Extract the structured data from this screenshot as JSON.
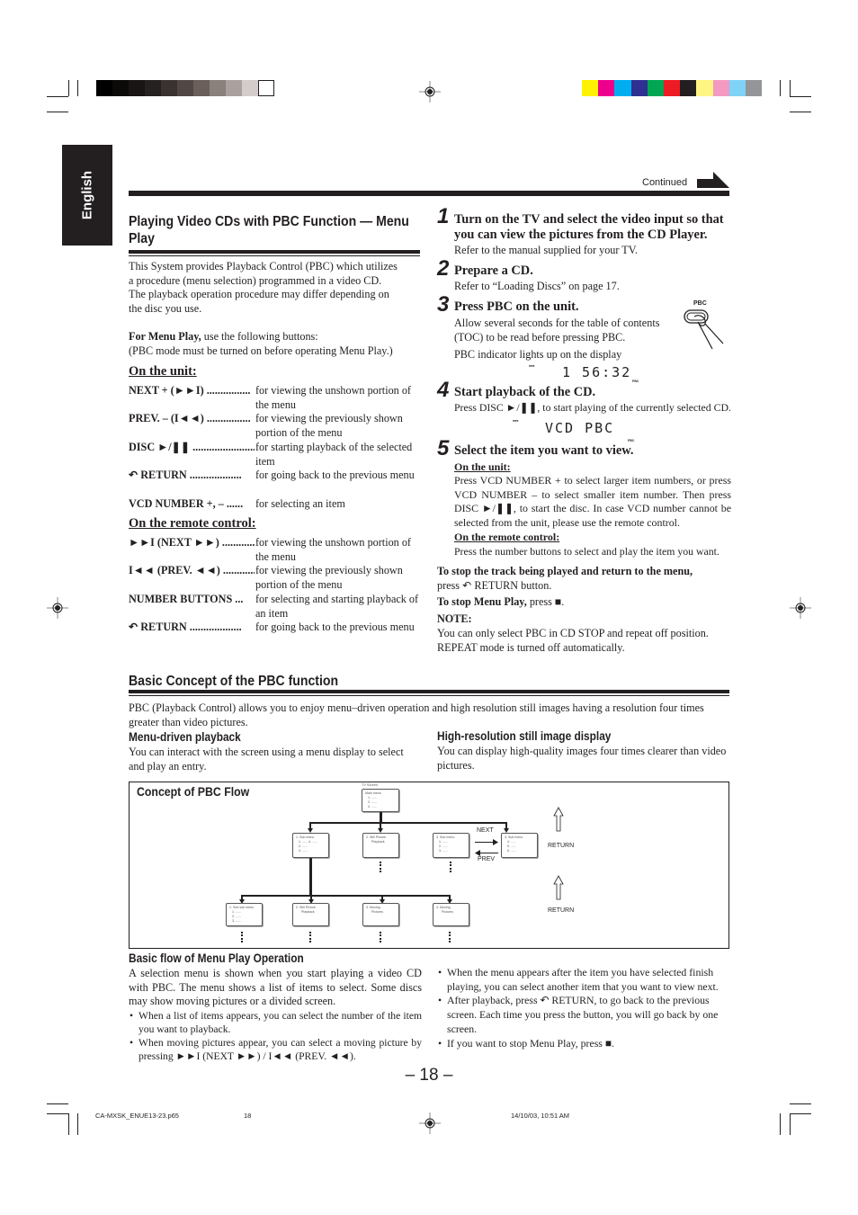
{
  "print_marks": {
    "grayscale_swatches": [
      "#000000",
      "#0b0a09",
      "#181514",
      "#252120",
      "#3a3230",
      "#514846",
      "#6a5f5b",
      "#8a807c",
      "#aaa19e",
      "#d4cccb",
      "#ffffff"
    ],
    "color_swatches": [
      "#fff200",
      "#ec008c",
      "#00aeef",
      "#2e3192",
      "#00a651",
      "#ed1c24",
      "#231f20",
      "#fff582",
      "#f49ac1",
      "#7fd3f7",
      "#939598"
    ]
  },
  "language_tab": "English",
  "continued_label": "Continued",
  "left": {
    "title_line1": "Playing Video CDs with PBC Function — Menu",
    "title_line2": "Play",
    "intro": [
      "This System provides Playback Control (PBC) which utilizes",
      "a procedure (menu selection) programmed in a video CD.",
      "The playback operation procedure may differ depending on",
      "the disc you use."
    ],
    "menu_play_bold": "For Menu Play,",
    "menu_play_rest": " use the following buttons:",
    "menu_play_note": "(PBC mode must be turned on before operating Menu Play.)",
    "unit_heading": "On the unit:",
    "unit_buttons": [
      {
        "key": "NEXT + (►►I) ................",
        "desc": "for viewing the unshown portion of the menu"
      },
      {
        "key": "PREV. – (I◄◄) ................",
        "desc": "for viewing the previously shown portion of the menu"
      },
      {
        "key": "DISC ►/❚❚ ........................",
        "desc": "for starting playback of the selected item"
      },
      {
        "key": "↶ RETURN ...................",
        "desc": "for going back to the previous menu"
      },
      {
        "key": "VCD NUMBER +, – ......",
        "desc": "for selecting an item"
      }
    ],
    "remote_heading": "On the remote control:",
    "remote_buttons": [
      {
        "key": "►►I (NEXT ►►) ............",
        "desc": "for viewing the unshown portion of the menu"
      },
      {
        "key": "I◄◄ (PREV. ◄◄) ............",
        "desc": "for viewing the previously shown portion  of the menu"
      },
      {
        "key": "NUMBER BUTTONS ...",
        "desc": "for selecting and starting playback of an item"
      },
      {
        "key": "↶ RETURN ...................",
        "desc": "for going back to the previous menu"
      }
    ]
  },
  "steps": [
    {
      "num": "1",
      "title": "Turn on the TV and select the video input so that you can view the pictures from the CD Player.",
      "body": "Refer to the manual supplied for your TV."
    },
    {
      "num": "2",
      "title": "Prepare a CD.",
      "body": "Refer to “Loading Discs” on page 17."
    },
    {
      "num": "3",
      "title": "Press PBC on the unit.",
      "body": "Allow several seconds for the table of contents (TOC) to be read before pressing PBC.",
      "body2": "PBC indicator lights up on the display",
      "button_label": "PBC",
      "display": "1 56:32",
      "display_indicator": "PBC"
    },
    {
      "num": "4",
      "title": "Start playback of the CD.",
      "body": "Press DISC ►/❚❚, to start playing of the currently selected CD.",
      "display": "VCD PBC",
      "display_indicator": "PBC"
    },
    {
      "num": "5",
      "title": "Select the item you want to view.",
      "unit_heading": "On the unit:",
      "unit_body": "Press VCD NUMBER + to select larger item numbers, or press VCD NUMBER –  to select smaller item number. Then press DISC ►/❚❚, to start the disc. In case VCD number cannot be selected from the unit, please use the remote control.",
      "remote_heading": "On the remote control:",
      "remote_body": "Press the number buttons to select and play the item you want."
    }
  ],
  "stop_track_bold": "To stop the track being played and return to the menu,",
  "stop_track_rest": "press ↶ RETURN button.",
  "stop_menu_bold": "To stop Menu Play,",
  "stop_menu_rest": " press ■.",
  "note_heading": "NOTE:",
  "note_lines": [
    "You can only select PBC in CD STOP and repeat off position.",
    "REPEAT mode is turned off automatically."
  ],
  "basic": {
    "title": "Basic Concept of the PBC function",
    "intro": "PBC (Playback Control) allows you to enjoy menu–driven operation and high resolution still images having a resolution four times greater than video pictures.",
    "menu_driven_title": "Menu-driven playback",
    "menu_driven_body": "You can interact with the screen using a menu display to select and play an entry.",
    "hires_title": "High-resolution still image display",
    "hires_body": "You can display high-quality images four times clearer than video pictures."
  },
  "diagram": {
    "title": "Concept of PBC Flow",
    "tv_screen_label": "TV Screen",
    "main_menu": [
      "Main menu",
      "1. ......",
      "2. ......",
      "3. ......"
    ],
    "level1": [
      [
        "1. Sub menu",
        "1. ...... 4. ......",
        "2. ......",
        "3. ......"
      ],
      [
        "2. Still Picture",
        "Playback"
      ],
      [
        "3. Sub menu",
        "1. ......",
        "2. ......",
        "3. ......"
      ],
      [
        "3. Sub menu",
        "4. ......",
        "5. ......",
        "6. ......"
      ]
    ],
    "level2": [
      [
        "1. Sub sub menu",
        "1. ......",
        "2. ......",
        "3. ......"
      ],
      [
        "2. Still Picture",
        "Playback"
      ],
      [
        "3. Moving",
        "Pictures"
      ],
      [
        "4. Moving",
        "Pictures"
      ]
    ],
    "next_label": "NEXT",
    "prev_label": "PREV",
    "return_label": "RETURN"
  },
  "flow": {
    "title": "Basic flow of Menu Play Operation",
    "intro": "A selection menu is shown when you start playing a video CD with PBC. The menu shows a list of items to select. Some discs may show moving pictures or a divided screen.",
    "bullets_left": [
      "When a list of items appears, you can select the number of the item you want to playback.",
      "When moving pictures appear, you can select a moving picture by pressing ►►I (NEXT ►►) / I◄◄ (PREV. ◄◄)."
    ],
    "bullets_right": [
      "When the menu appears after the item you have selected finish playing, you can select another item that you want to view next.",
      "After playback, press ↶ RETURN, to go back to the previous screen. Each time you press the button, you will go back by one screen.",
      "If you want to stop Menu Play, press ■."
    ]
  },
  "page_number": "– 18 –",
  "footer": {
    "file": "CA-MXSK_ENUE13-23.p65",
    "page": "18",
    "timestamp": "14/10/03, 10:51 AM"
  }
}
